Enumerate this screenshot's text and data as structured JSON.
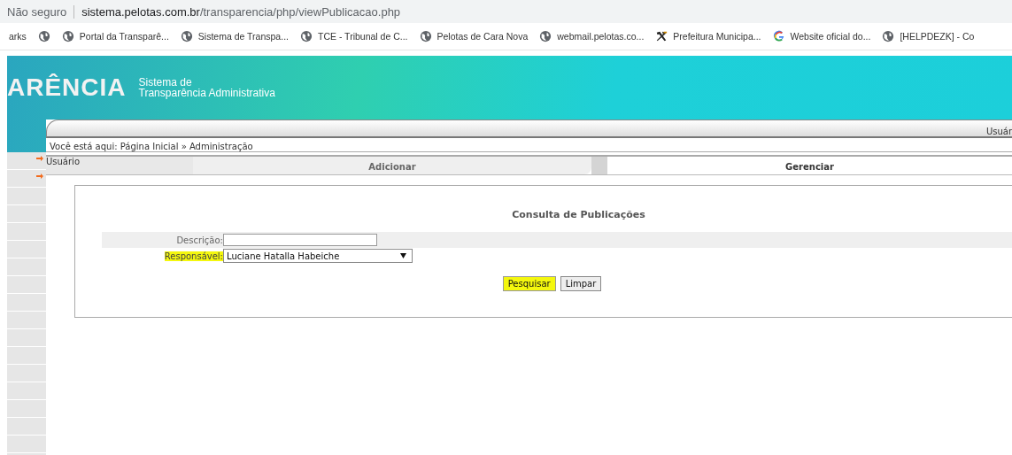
{
  "address_bar": {
    "security": "Não seguro",
    "url_host": "sistema.pelotas.com.br",
    "url_path": "/transparencia/php/viewPublicacao.php"
  },
  "bookmarks": [
    {
      "kind": "plain",
      "label": "arks"
    },
    {
      "kind": "globe"
    },
    {
      "kind": "globe",
      "label": "Portal da Transparê..."
    },
    {
      "kind": "globe",
      "label": "Sistema de Transpa..."
    },
    {
      "kind": "globe",
      "label": "TCE - Tribunal de C..."
    },
    {
      "kind": "globe",
      "label": "Pelotas de Cara Nova"
    },
    {
      "kind": "globe",
      "label": "webmail.pelotas.co..."
    },
    {
      "kind": "tools",
      "label": "Prefeitura Municipa..."
    },
    {
      "kind": "g",
      "label": "Website oficial do..."
    },
    {
      "kind": "globe",
      "label": "[HELPDEZK] - Co"
    }
  ],
  "header": {
    "logo": "ARÊNCIA",
    "subtitle_line_1": "Sistema de",
    "subtitle_line_2": "Transparência Administrativa",
    "user_label": "Usuár"
  },
  "breadcrumb": "Você está aqui: Página Inicial » Administração",
  "sidebar": {
    "items": [
      {
        "kind": "arrow",
        "label": "Usuário"
      },
      {
        "kind": "arrow"
      }
    ]
  },
  "tabs": [
    {
      "label": "Adicionar",
      "selected": false
    },
    {
      "label": "Gerenciar",
      "selected": true
    }
  ],
  "form": {
    "title": "Consulta de Publicações",
    "fields": [
      {
        "kind": "text",
        "label": "Descrição:",
        "highlighted": false
      },
      {
        "kind": "select",
        "label": "Responsável:",
        "value": "Luciane Hatalla Habeiche",
        "highlighted": true
      }
    ],
    "buttons": [
      {
        "label": "Pesquisar",
        "highlighted": true
      },
      {
        "label": "Limpar",
        "highlighted": false
      }
    ]
  }
}
